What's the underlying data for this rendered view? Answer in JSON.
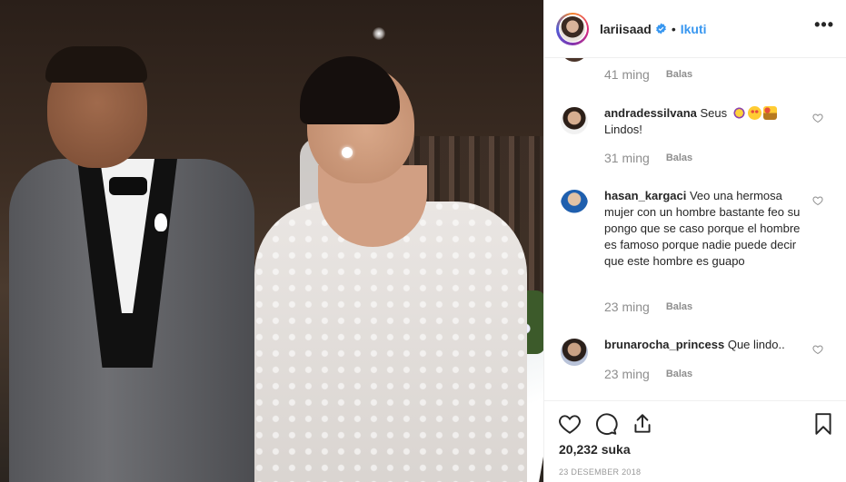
{
  "post": {
    "username": "lariisaad",
    "separator": "•",
    "follow_label": "Ikuti",
    "more_label": "•••",
    "likes": "20,232 suka",
    "date": "23 DESEMBER 2018"
  },
  "comments": {
    "top_partial": {
      "time": "41 ming",
      "reply": "Balas"
    },
    "items": [
      {
        "user": "andradessilvana",
        "text": "Seus",
        "text2": "Lindos!",
        "time": "31 ming",
        "reply": "Balas"
      },
      {
        "user": "hasan_kargaci",
        "text": "Veo una hermosa mujer con un hombre bastante feo su pongo que se caso porque el hombre es famoso porque nadie puede decir que este hombre es guapo",
        "time": "23 ming",
        "reply": "Balas"
      },
      {
        "user": "brunarocha_princess",
        "text": "Que lindo..",
        "time": "23 ming",
        "reply": "Balas"
      }
    ]
  },
  "icons": [
    "heart-icon",
    "comment-icon",
    "share-icon",
    "bookmark-icon",
    "verified-icon",
    "more-icon"
  ],
  "colors": {
    "link": "#3897f0",
    "text": "#262626",
    "muted": "#8e8e8e",
    "verified": "#3897f0"
  }
}
